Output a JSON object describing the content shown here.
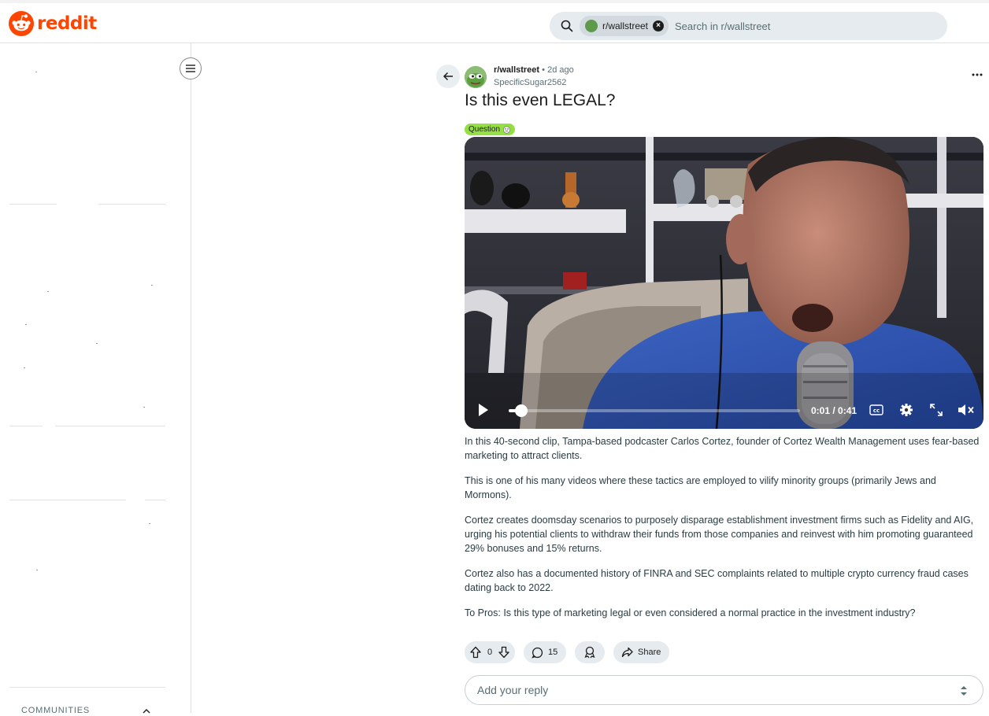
{
  "header": {
    "logo_text": "reddit",
    "search": {
      "chip_label": "r/wallstreet",
      "placeholder": "Search in r/wallstreet"
    }
  },
  "sidebar": {
    "communities_label": "COMMUNITIES"
  },
  "post": {
    "subreddit": "r/wallstreet",
    "separator": "•",
    "time_ago": "2d ago",
    "author": "SpecificSugar2562",
    "title": "Is this even LEGAL?",
    "flair": "Question",
    "video": {
      "time": "0:01 / 0:41",
      "progress": 0.024
    },
    "body": [
      "In this 40-second clip, Tampa-based podcaster Carlos Cortez, founder of Cortez Wealth Management uses fear-based marketing to attract clients.",
      "This is one of his many videos where these tactics are employed to vilify minority groups (primarily Jews and Mormons).",
      "Cortez creates doomsday scenarios to purposely disparage establishment investment firms such as Fidelity and AIG, urging his potential clients to withdraw their funds from those companies and reinvest with him promoting guaranteed 29% bonuses and 15% returns.",
      "Cortez also has a documented history of FINRA and SEC complaints related to multiple crypto currency fraud cases dating back to 2022.",
      "To Pros: Is this type of marketing legal or even considered a normal practice in the investment industry?"
    ],
    "votes": "0",
    "comments": "15",
    "share_label": "Share"
  },
  "reply": {
    "placeholder": "Add your reply"
  },
  "colors": {
    "brand": "#ff4500",
    "flair": "#94e044",
    "pill_bg": "#e5ebee"
  }
}
